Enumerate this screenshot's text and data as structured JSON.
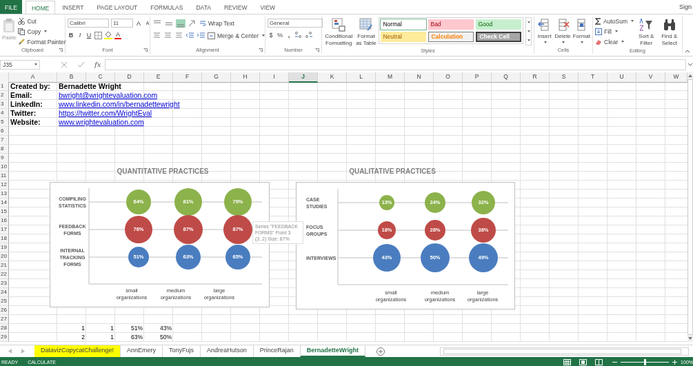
{
  "ribbon_tabs": [
    {
      "label": "FILE",
      "kind": "file",
      "selected": false
    },
    {
      "label": "HOME",
      "kind": "tab",
      "selected": true
    },
    {
      "label": "INSERT",
      "kind": "tab",
      "selected": false
    },
    {
      "label": "PAGE LAYOUT",
      "kind": "tab",
      "selected": false
    },
    {
      "label": "FORMULAS",
      "kind": "tab",
      "selected": false
    },
    {
      "label": "DATA",
      "kind": "tab",
      "selected": false
    },
    {
      "label": "REVIEW",
      "kind": "tab",
      "selected": false
    },
    {
      "label": "VIEW",
      "kind": "tab",
      "selected": false
    }
  ],
  "account": "Sign",
  "clipboard": {
    "label": "Clipboard",
    "paste": {
      "label": "Paste",
      "disabled": true
    },
    "cut": "Cut",
    "copy": "Copy",
    "format_painter": "Format Painter"
  },
  "font": {
    "label": "Font",
    "name": "Calibri",
    "size": "11",
    "grow": "A",
    "shrink": "A",
    "bold": "B",
    "italic": "I",
    "underline": "U",
    "color_button": "A"
  },
  "alignment": {
    "label": "Alignment",
    "vertical": [
      {
        "selected": false
      },
      {
        "selected": false
      },
      {
        "selected": true
      }
    ],
    "wrap": "Wrap Text",
    "merge": "Merge & Center"
  },
  "number": {
    "label": "Number",
    "format": "General",
    "currency": "$",
    "percent": "%",
    "comma": ","
  },
  "styles": {
    "label": "Styles",
    "conditional": "Conditional Formatting",
    "table": "Format as Table",
    "gallery": [
      {
        "label": "Normal",
        "kind": "normal",
        "selected": true
      },
      {
        "label": "Bad",
        "kind": "bad",
        "selected": false
      },
      {
        "label": "Good",
        "kind": "good",
        "selected": false
      },
      {
        "label": "Neutral",
        "kind": "neutral",
        "selected": false
      },
      {
        "label": "Calculation",
        "kind": "calculation",
        "selected": false
      },
      {
        "label": "Check Cell",
        "kind": "check",
        "selected": false
      }
    ]
  },
  "cells": {
    "label": "Cells",
    "buttons": [
      {
        "label": "Insert",
        "kind": "insert"
      },
      {
        "label": "Delete",
        "kind": "delete"
      },
      {
        "label": "Format",
        "kind": "format"
      }
    ]
  },
  "editing": {
    "label": "Editing",
    "autosum": "AutoSum",
    "fill": "Fill",
    "clear": "Clear",
    "sort": "Sort & Filter",
    "find": "Find & Select"
  },
  "formula_bar": {
    "name_box": "J35",
    "function_label": "fx"
  },
  "columns": [
    {
      "label": "A",
      "selected": false
    },
    {
      "label": "B",
      "selected": false
    },
    {
      "label": "C",
      "selected": false
    },
    {
      "label": "D",
      "selected": false
    },
    {
      "label": "E",
      "selected": false
    },
    {
      "label": "F",
      "selected": false
    },
    {
      "label": "G",
      "selected": false
    },
    {
      "label": "H",
      "selected": false
    },
    {
      "label": "I",
      "selected": false
    },
    {
      "label": "J",
      "selected": true
    },
    {
      "label": "K",
      "selected": false
    },
    {
      "label": "L",
      "selected": false
    },
    {
      "label": "M",
      "selected": false
    },
    {
      "label": "N",
      "selected": false
    },
    {
      "label": "O",
      "selected": false
    },
    {
      "label": "P",
      "selected": false
    },
    {
      "label": "Q",
      "selected": false
    },
    {
      "label": "R",
      "selected": false
    },
    {
      "label": "S",
      "selected": false
    },
    {
      "label": "T",
      "selected": false
    },
    {
      "label": "U",
      "selected": false
    },
    {
      "label": "V",
      "selected": false
    },
    {
      "label": "W",
      "selected": false
    }
  ],
  "rows": [
    {
      "number": "1",
      "kind": "title",
      "a": "Created by:",
      "b": "Bernadette Wright"
    },
    {
      "number": "2",
      "kind": "link",
      "a": "Email:",
      "b": "bwright@wrightevaluation.com"
    },
    {
      "number": "3",
      "kind": "link",
      "a": "LinkedIn:",
      "b": "www.linkedin.com/in/bernadettewright"
    },
    {
      "number": "4",
      "kind": "link",
      "a": "Twitter:",
      "b": "https://twitter.com/WrightEval"
    },
    {
      "number": "5",
      "kind": "link",
      "a": "Website:",
      "b": "www.wrightevaluation.com"
    },
    {
      "number": "6"
    },
    {
      "number": "7"
    },
    {
      "number": "8"
    },
    {
      "number": "9"
    },
    {
      "number": "10"
    },
    {
      "number": "11"
    },
    {
      "number": "12"
    },
    {
      "number": "13"
    },
    {
      "number": "14"
    },
    {
      "number": "15"
    },
    {
      "number": "16"
    },
    {
      "number": "17"
    },
    {
      "number": "18"
    },
    {
      "number": "19"
    },
    {
      "number": "20"
    },
    {
      "number": "21"
    },
    {
      "number": "22"
    },
    {
      "number": "23"
    },
    {
      "number": "24"
    },
    {
      "number": "25"
    },
    {
      "number": "26"
    },
    {
      "number": "27"
    },
    {
      "number": "28",
      "kind": "number",
      "b": "1",
      "c": "1",
      "d": "51%",
      "e": "43%"
    },
    {
      "number": "29",
      "kind": "number",
      "b": "2",
      "c": "1",
      "d": "63%",
      "e": "50%"
    }
  ],
  "charts": [
    {
      "title": "QUANTITATIVE PRACTICES",
      "columns": [
        "small organizations",
        "medium organizations",
        "large organizations"
      ],
      "rows": [
        {
          "label": "COMPILING STATISTICS",
          "color": "#8cb24b",
          "bubbles": [
            {
              "label": "64%",
              "kind": "l"
            },
            {
              "label": "81%",
              "kind": "xl"
            },
            {
              "label": "79%",
              "kind": "xl"
            }
          ]
        },
        {
          "label": "FEEDBACK FORMS",
          "color": "#bf4b48",
          "bubbles": [
            {
              "label": "76%",
              "kind": "xl"
            },
            {
              "label": "87%",
              "kind": "xxl"
            },
            {
              "label": "87%",
              "kind": "xxl"
            }
          ]
        },
        {
          "label": "INTERNAL TRACKING FORMS",
          "color": "#4a7dbf",
          "bubbles": [
            {
              "label": "51%",
              "kind": "m"
            },
            {
              "label": "63%",
              "kind": "l"
            },
            {
              "label": "65%",
              "kind": "l"
            }
          ]
        }
      ]
    },
    {
      "title": "QUALITATIVE PRACTICES",
      "columns": [
        "small organizations",
        "medium organizations",
        "large organizations"
      ],
      "rows": [
        {
          "label": "CASE STUDIES",
          "color": "#8cb24b",
          "bubbles": [
            {
              "label": "13%",
              "kind": "xs"
            },
            {
              "label": "24%",
              "kind": "m"
            },
            {
              "label": "32%",
              "kind": "ml"
            }
          ]
        },
        {
          "label": "FOCUS GROUPS",
          "color": "#bf4b48",
          "bubbles": [
            {
              "label": "18%",
              "kind": "s"
            },
            {
              "label": "28%",
              "kind": "m"
            },
            {
              "label": "38%",
              "kind": "l"
            }
          ]
        },
        {
          "label": "INTERVIEWS",
          "color": "#4a7dbf",
          "bubbles": [
            {
              "label": "43%",
              "kind": "xl"
            },
            {
              "label": "50%",
              "kind": "xxl"
            },
            {
              "label": "49%",
              "kind": "xxl"
            }
          ]
        }
      ]
    }
  ],
  "tooltip": {
    "lines": [
      "Series \"FEEDBACK FORMS\" Point 3",
      "(3, 2) Size: 87%"
    ]
  },
  "sheet_tabs": [
    {
      "label": "DatavizCopycatChallenge!",
      "selected": false,
      "color": "#ffff00"
    },
    {
      "label": "AnnEmery",
      "selected": false
    },
    {
      "label": "TonyFujs",
      "selected": false
    },
    {
      "label": "AndreaHutson",
      "selected": false
    },
    {
      "label": "PrinceRajan",
      "selected": false
    },
    {
      "label": "BernadetteWright",
      "selected": true
    }
  ],
  "status_bar": {
    "mode": "READY",
    "calculate": "CALCULATE",
    "zoom": "100%",
    "zoom_slider": {
      "level": 0.5
    }
  }
}
